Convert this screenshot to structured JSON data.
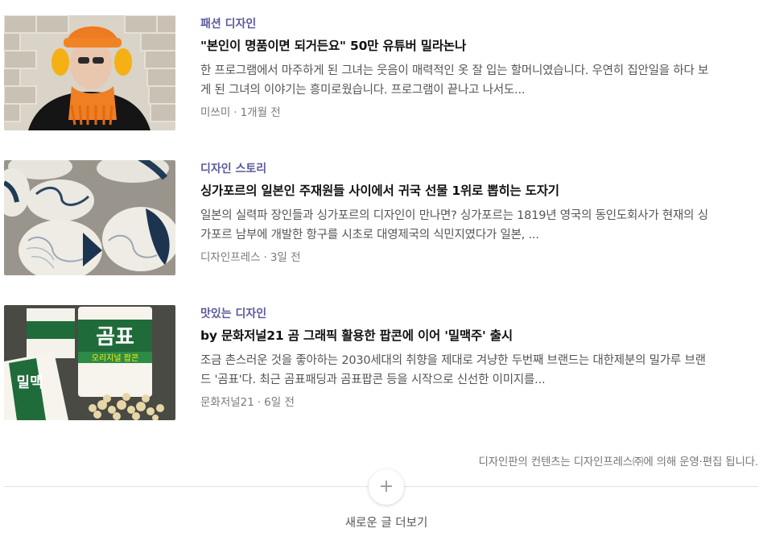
{
  "articles": [
    {
      "category": "패션 디자인",
      "title": "\"본인이 명품이면 되거든요\" 50만 유튜버 밀라논나",
      "summary": "한 프로그램에서 마주하게 된 그녀는 웃음이 매력적인 옷 잘 입는 할머니였습니다. 우연히 집안일을 하다 보게 된 그녀의 이야기는 흥미로웠습니다. 프로그램이 끝나고 나서도...",
      "author": "미쓰미",
      "time": "1개월 전",
      "thumb_icon": "fashion-photo"
    },
    {
      "category": "디자인 스토리",
      "title": "싱가포르의 일본인 주재원들 사이에서 귀국 선물 1위로 뽑히는 도자기",
      "summary": "일본의 실력파 장인들과 싱가포르의 디자인이 만나면? 싱가포르는 1819년 영국의 동인도회사가 현재의 싱가포르 남부에 개발한 항구를 시초로 대영제국의 식민지였다가 일본, ...",
      "author": "디자인프레스",
      "time": "3일 전",
      "thumb_icon": "ceramic-plates-photo"
    },
    {
      "category": "맛있는 디자인",
      "title": "by 문화저널21 곰 그래픽 활용한 팝콘에 이어 '밀맥주' 출시",
      "summary": "조금 촌스러운 것을 좋아하는 2030세대의 취향을 제대로 겨냥한 두번째 브랜드는 대한제분의 밀가루 브랜드 '곰표'다. 최근 곰표패딩과 곰표팝콘 등을 시작으로 신선한 이미지를...",
      "author": "문화저널21",
      "time": "6일 전",
      "thumb_icon": "popcorn-bag-photo",
      "thumb_text": {
        "brand": "곰표",
        "sub": "오리지널 팝콘",
        "side": "밀맥"
      }
    }
  ],
  "footer_note": "디자인판의 컨텐츠는 디자인프레스㈜에 의해 운영·편집 됩니다.",
  "more": {
    "icon": "+",
    "label": "새로운 글 더보기"
  },
  "colors": {
    "category": "#5a5a9f",
    "summary": "#555555",
    "meta": "#7a7a7a"
  }
}
